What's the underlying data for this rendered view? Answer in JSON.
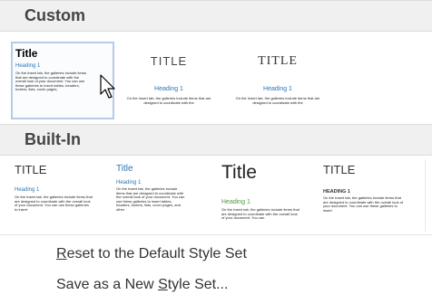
{
  "custom": {
    "header": "Custom",
    "styles": [
      {
        "title": "Title",
        "heading": "Heading 1",
        "body": "On the Insert tab, the galleries include items that are designed to coordinate with the overall look of your document. You can use these galleries to insert tables, headers, footers, lists, cover pages,"
      },
      {
        "title": "TITLE",
        "heading": "Heading 1",
        "body": "On the Insert tab, the galleries include items that are designed to coordinate with the"
      },
      {
        "title": "TITLE",
        "heading": "Heading 1",
        "body": "On the Insert tab, the galleries include items that are designed to coordinate with the"
      }
    ]
  },
  "builtin": {
    "header": "Built-In",
    "styles": [
      {
        "title": "TITLE",
        "heading": "Heading 1",
        "body": "On the Insert tab, the galleries include items that are designed to coordinate with the overall look of your document. You can use these galleries to insert"
      },
      {
        "title": "Title",
        "heading": "Heading 1",
        "body": "On the Insert tab, the galleries include items that are designed to coordinate with the overall look of your document. You can use these galleries to insert tables, headers, footers, lists, cover pages, and other"
      },
      {
        "title": "Title",
        "heading": "Heading 1",
        "body": "On the Insert tab, the galleries include items that are designed to coordinate with the overall look of your document. You can"
      },
      {
        "title": "TITLE",
        "heading": "HEADING 1",
        "body": "On the Insert tab, the galleries include items that are designed to coordinate with the overall look of your document. You can use these galleries to insert"
      }
    ]
  },
  "menu": {
    "reset": {
      "before": "",
      "accel": "R",
      "after": "eset to the Default Style Set"
    },
    "save": {
      "before": "Save as a New ",
      "accel": "S",
      "after": "tyle Set..."
    }
  },
  "colors": {
    "heading_blue": "#2e74b5",
    "heading_green": "#4f9a3a",
    "selection_border": "#b7cbe8",
    "header_bg": "#f0f0f0"
  },
  "icons": {
    "cursor": "arrow-pointer-icon"
  }
}
